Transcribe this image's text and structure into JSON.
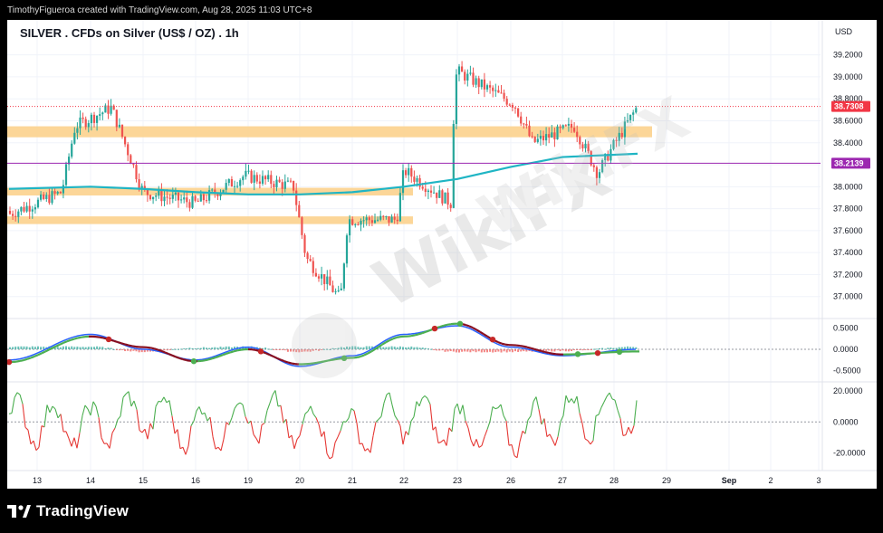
{
  "header": {
    "attribution": "TimothyFigueroa created with TradingView.com, Aug 28, 2025 11:03 UTC+8"
  },
  "chart_title": "SILVER . CFDs on Silver (US$ / OZ) . 1h",
  "branding": {
    "logo_text": "TradingView",
    "watermark_text": "WikiFX"
  },
  "colors": {
    "candle_up": "#26a69a",
    "candle_down": "#ef5350",
    "ema_line": "#1fb5c4",
    "zone_fill": "#fbcf86",
    "last_price_tag": "#f23645",
    "level_line_tag": "#9c27b0",
    "macd_line": "#2962ff",
    "signal_line_up": "#4caf50",
    "signal_line_down": "#880e1f",
    "osc_up": "#4caf50",
    "osc_down": "#e53935"
  },
  "chart_data": [
    {
      "type": "candlestick",
      "title": "SILVER . CFDs on Silver (US$ / OZ) . 1h",
      "currency_label": "USD",
      "x_ticks": [
        "13",
        "14",
        "15",
        "16",
        "19",
        "20",
        "21",
        "22",
        "23",
        "26",
        "27",
        "28",
        "29",
        "Sep",
        "2",
        "3"
      ],
      "y_ticks": [
        "39.2000",
        "39.0000",
        "38.8000",
        "38.6000",
        "38.4000",
        "38.2000",
        "38.0000",
        "37.8000",
        "37.6000",
        "37.4000",
        "37.2000",
        "37.0000"
      ],
      "ylim": [
        36.8,
        39.37
      ],
      "session_closes": {
        "x": [
          "13",
          "14",
          "15",
          "16",
          "19",
          "20",
          "21",
          "22",
          "23",
          "26",
          "27",
          "28"
        ],
        "close": [
          37.9,
          38.65,
          38.0,
          37.9,
          38.05,
          37.35,
          37.85,
          38.15,
          38.95,
          38.45,
          38.45,
          38.73
        ]
      },
      "key_points": [
        {
          "x": "13",
          "close": 37.75,
          "label": "start"
        },
        {
          "x": "14",
          "close": 38.72,
          "label": "high"
        },
        {
          "x": "20",
          "close": 36.98,
          "label": "low"
        },
        {
          "x": "23",
          "close": 39.05,
          "label": "high"
        },
        {
          "x": "27",
          "close": 38.12,
          "label": "dip"
        },
        {
          "x": "28",
          "close": 38.7308,
          "label": "last"
        }
      ],
      "ema_values": [
        37.98,
        38.0,
        37.98,
        37.95,
        37.93,
        37.93,
        37.95,
        38.0,
        38.07,
        38.18,
        38.27,
        38.3
      ],
      "last_price": "38.7308",
      "horizontal_line": "38.2139",
      "zones": [
        {
          "low": 38.45,
          "high": 38.55
        },
        {
          "low": 37.92,
          "high": 37.99
        },
        {
          "low": 37.66,
          "high": 37.73
        }
      ]
    },
    {
      "type": "line",
      "title": "MACD panel",
      "y_ticks": [
        "0.5000",
        "0.0000",
        "-0.5000"
      ],
      "ylim": [
        -0.72,
        0.72
      ],
      "x": [
        "13",
        "14",
        "15",
        "16",
        "19",
        "20",
        "21",
        "22",
        "23",
        "26",
        "27",
        "28"
      ],
      "series": [
        {
          "values": [
            -0.25,
            0.35,
            0.0,
            -0.25,
            0.05,
            -0.4,
            -0.15,
            0.35,
            0.55,
            0.05,
            -0.15,
            0.0
          ]
        },
        {
          "values": [
            -0.3,
            0.3,
            0.05,
            -0.28,
            0.0,
            -0.35,
            -0.2,
            0.3,
            0.6,
            0.1,
            -0.12,
            -0.05
          ]
        }
      ]
    },
    {
      "type": "line",
      "title": "Oscillator panel",
      "y_ticks": [
        "20.0000",
        "0.0000",
        "-20.0000"
      ],
      "ylim": [
        -28,
        26
      ],
      "x": [
        "13",
        "14",
        "15",
        "16",
        "19",
        "20",
        "21",
        "22",
        "23",
        "26",
        "27",
        "28"
      ],
      "series": [
        {
          "values": [
            5,
            -10,
            15,
            -12,
            10,
            -5,
            -20,
            12,
            -8,
            -15,
            8,
            20
          ]
        }
      ]
    }
  ]
}
